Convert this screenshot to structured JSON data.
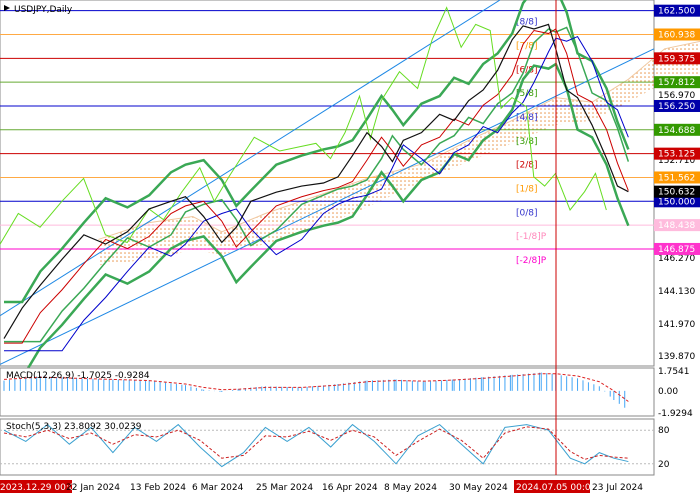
{
  "window": {
    "title": "USDJPY,Daily"
  },
  "chart_data": {
    "type": "line",
    "symbol": "USDJPY",
    "timeframe": "Daily",
    "price_axis": {
      "range": [
        139.2,
        163.2
      ],
      "ticks": [
        "156.970",
        "152.710",
        "146.270",
        "144.130",
        "141.970",
        "139.870"
      ]
    },
    "price_levels": [
      {
        "value": 162.5,
        "label": "162.500",
        "bg": "#0000aa",
        "murrey": "[8/8]",
        "mcolor": "#3333cc",
        "line": "#0000cc"
      },
      {
        "value": 160.938,
        "label": "160.938",
        "bg": "#ff9900",
        "murrey": "[7/8]",
        "mcolor": "#ff9900",
        "line": "#ffaa44"
      },
      {
        "value": 159.375,
        "label": "159.375",
        "bg": "#cc0000",
        "murrey": "[6/8]",
        "mcolor": "#cc0000",
        "line": "#cc0000"
      },
      {
        "value": 157.812,
        "label": "157.812",
        "bg": "#339900",
        "murrey": "[5/8]",
        "mcolor": "#339900",
        "line": "#66aa33"
      },
      {
        "value": 156.25,
        "label": "156.250",
        "bg": "#0000aa",
        "murrey": "[4/8]",
        "mcolor": "#3333cc",
        "line": "#0000cc"
      },
      {
        "value": 154.688,
        "label": "154.688",
        "bg": "#339900",
        "murrey": "[3/8]",
        "mcolor": "#339900",
        "line": "#66aa33"
      },
      {
        "value": 153.125,
        "label": "153.125",
        "bg": "#cc0000",
        "murrey": "[2/8]",
        "mcolor": "#cc0000",
        "line": "#cc0000"
      },
      {
        "value": 151.562,
        "label": "151.562",
        "bg": "#ff9900",
        "murrey": "[1/8]",
        "mcolor": "#ff9900",
        "line": "#ffaa44"
      },
      {
        "value": 150.0,
        "label": "150.000",
        "bg": "#0000aa",
        "murrey": "[0/8]",
        "mcolor": "#3333cc",
        "line": "#0000cc"
      },
      {
        "value": 148.438,
        "label": "148.438",
        "bg": "#ffbbdd",
        "murrey": "[-1/8]P",
        "mcolor": "#ff88bb",
        "line": "#ffbbdd"
      },
      {
        "value": 146.875,
        "label": "146.875",
        "bg": "#ff33cc",
        "murrey": "[-2/8]P",
        "mcolor": "#ff00cc",
        "line": "#ff00cc"
      }
    ],
    "last_price": {
      "value": 150.632,
      "label": "150.632"
    },
    "x_labels": [
      "2023.12.29 00:00",
      "22 Jan 2024",
      "13 Feb 2024",
      "6 Mar 2024",
      "25 Mar 2024",
      "16 Apr 2024",
      "8 May 2024",
      "30 May 2024",
      "2024.07.05 00:00",
      "23 Jul 2024"
    ],
    "price_series": [
      [
        0,
        141.0
      ],
      [
        5,
        143.0
      ],
      [
        10,
        144.5
      ],
      [
        16,
        146.2
      ],
      [
        22,
        147.8
      ],
      [
        28,
        147.2
      ],
      [
        34,
        148.0
      ],
      [
        40,
        149.5
      ],
      [
        46,
        150.0
      ],
      [
        50,
        150.3
      ],
      [
        55,
        149.0
      ],
      [
        60,
        147.3
      ],
      [
        64,
        148.3
      ],
      [
        68,
        150.0
      ],
      [
        75,
        150.6
      ],
      [
        82,
        151.0
      ],
      [
        88,
        151.2
      ],
      [
        92,
        151.6
      ],
      [
        96,
        153.0
      ],
      [
        100,
        154.5
      ],
      [
        104,
        153.6
      ],
      [
        107,
        152.6
      ],
      [
        110,
        154.0
      ],
      [
        115,
        154.5
      ],
      [
        120,
        155.7
      ],
      [
        124,
        155.3
      ],
      [
        128,
        156.6
      ],
      [
        132,
        157.3
      ],
      [
        136,
        158.6
      ],
      [
        140,
        160.6
      ],
      [
        143,
        161.5
      ],
      [
        146,
        161.3
      ],
      [
        150,
        161.6
      ],
      [
        152,
        160.0
      ],
      [
        155,
        157.3
      ],
      [
        158,
        156.8
      ],
      [
        162,
        155.0
      ],
      [
        166,
        152.8
      ],
      [
        169,
        151.0
      ],
      [
        172,
        150.63
      ]
    ],
    "ichimoku_cloud": {
      "span_a": [
        [
          26,
          147.5
        ],
        [
          40,
          148.6
        ],
        [
          52,
          149.0
        ],
        [
          60,
          148.0
        ],
        [
          72,
          149.2
        ],
        [
          88,
          150.5
        ],
        [
          100,
          151.5
        ],
        [
          116,
          152.5
        ],
        [
          128,
          154.0
        ],
        [
          140,
          155.3
        ],
        [
          152,
          156.8
        ],
        [
          162,
          156.5
        ],
        [
          172,
          158.0
        ],
        [
          182,
          160.0
        ],
        [
          192,
          160.5
        ]
      ],
      "span_b": [
        [
          26,
          145.8
        ],
        [
          40,
          146.2
        ],
        [
          52,
          146.8
        ],
        [
          60,
          146.5
        ],
        [
          72,
          147.2
        ],
        [
          88,
          148.4
        ],
        [
          100,
          149.6
        ],
        [
          116,
          151.4
        ],
        [
          128,
          152.6
        ],
        [
          140,
          153.8
        ],
        [
          152,
          155.0
        ],
        [
          162,
          155.3
        ],
        [
          172,
          156.5
        ],
        [
          182,
          157.8
        ],
        [
          192,
          158.2
        ]
      ]
    },
    "macd": {
      "label": "MACD(12,26,9) -1.7025 -0.9284",
      "ticks": [
        "1.7541",
        "0.00",
        "-1.9294"
      ],
      "range": [
        -2.2,
        2.0
      ],
      "histogram": [
        [
          0,
          0.9
        ],
        [
          10,
          1.3
        ],
        [
          20,
          1.1
        ],
        [
          30,
          1.0
        ],
        [
          40,
          0.9
        ],
        [
          50,
          0.5
        ],
        [
          55,
          0.1
        ],
        [
          60,
          -0.1
        ],
        [
          65,
          0.2
        ],
        [
          72,
          0.4
        ],
        [
          82,
          0.3
        ],
        [
          92,
          0.6
        ],
        [
          100,
          0.9
        ],
        [
          108,
          1.0
        ],
        [
          116,
          0.8
        ],
        [
          124,
          1.0
        ],
        [
          132,
          1.2
        ],
        [
          140,
          1.4
        ],
        [
          148,
          1.6
        ],
        [
          152,
          1.45
        ],
        [
          158,
          1.1
        ],
        [
          164,
          0.4
        ],
        [
          168,
          -0.8
        ],
        [
          172,
          -1.7
        ]
      ],
      "signal": [
        [
          0,
          1.0
        ],
        [
          10,
          1.2
        ],
        [
          20,
          1.1
        ],
        [
          30,
          1.0
        ],
        [
          40,
          0.9
        ],
        [
          50,
          0.6
        ],
        [
          55,
          0.3
        ],
        [
          60,
          0.1
        ],
        [
          65,
          0.15
        ],
        [
          72,
          0.3
        ],
        [
          82,
          0.3
        ],
        [
          92,
          0.5
        ],
        [
          100,
          0.8
        ],
        [
          108,
          0.9
        ],
        [
          116,
          0.85
        ],
        [
          124,
          0.95
        ],
        [
          132,
          1.1
        ],
        [
          140,
          1.3
        ],
        [
          148,
          1.5
        ],
        [
          152,
          1.5
        ],
        [
          158,
          1.3
        ],
        [
          164,
          0.8
        ],
        [
          168,
          0.0
        ],
        [
          172,
          -0.93
        ]
      ]
    },
    "stochastic": {
      "label": "Stoch(5,3,3) 23.8092 30.0239",
      "ticks": [
        "80",
        "20"
      ],
      "range": [
        0,
        100
      ],
      "k": [
        [
          0,
          80
        ],
        [
          6,
          60
        ],
        [
          12,
          90
        ],
        [
          18,
          55
        ],
        [
          24,
          85
        ],
        [
          30,
          40
        ],
        [
          36,
          85
        ],
        [
          42,
          60
        ],
        [
          48,
          90
        ],
        [
          54,
          50
        ],
        [
          60,
          15
        ],
        [
          66,
          40
        ],
        [
          72,
          85
        ],
        [
          78,
          60
        ],
        [
          84,
          85
        ],
        [
          90,
          50
        ],
        [
          96,
          90
        ],
        [
          102,
          60
        ],
        [
          108,
          20
        ],
        [
          114,
          70
        ],
        [
          120,
          90
        ],
        [
          126,
          55
        ],
        [
          132,
          20
        ],
        [
          138,
          85
        ],
        [
          144,
          90
        ],
        [
          150,
          80
        ],
        [
          156,
          30
        ],
        [
          160,
          20
        ],
        [
          164,
          40
        ],
        [
          168,
          30
        ],
        [
          172,
          24
        ]
      ],
      "d": [
        [
          0,
          75
        ],
        [
          6,
          68
        ],
        [
          12,
          80
        ],
        [
          18,
          65
        ],
        [
          24,
          75
        ],
        [
          30,
          55
        ],
        [
          36,
          72
        ],
        [
          42,
          68
        ],
        [
          48,
          80
        ],
        [
          54,
          62
        ],
        [
          60,
          30
        ],
        [
          66,
          35
        ],
        [
          72,
          70
        ],
        [
          78,
          68
        ],
        [
          84,
          78
        ],
        [
          90,
          62
        ],
        [
          96,
          80
        ],
        [
          102,
          68
        ],
        [
          108,
          35
        ],
        [
          114,
          60
        ],
        [
          120,
          82
        ],
        [
          126,
          62
        ],
        [
          132,
          30
        ],
        [
          138,
          75
        ],
        [
          144,
          86
        ],
        [
          150,
          82
        ],
        [
          156,
          42
        ],
        [
          160,
          28
        ],
        [
          164,
          35
        ],
        [
          168,
          32
        ],
        [
          172,
          30
        ]
      ]
    }
  }
}
